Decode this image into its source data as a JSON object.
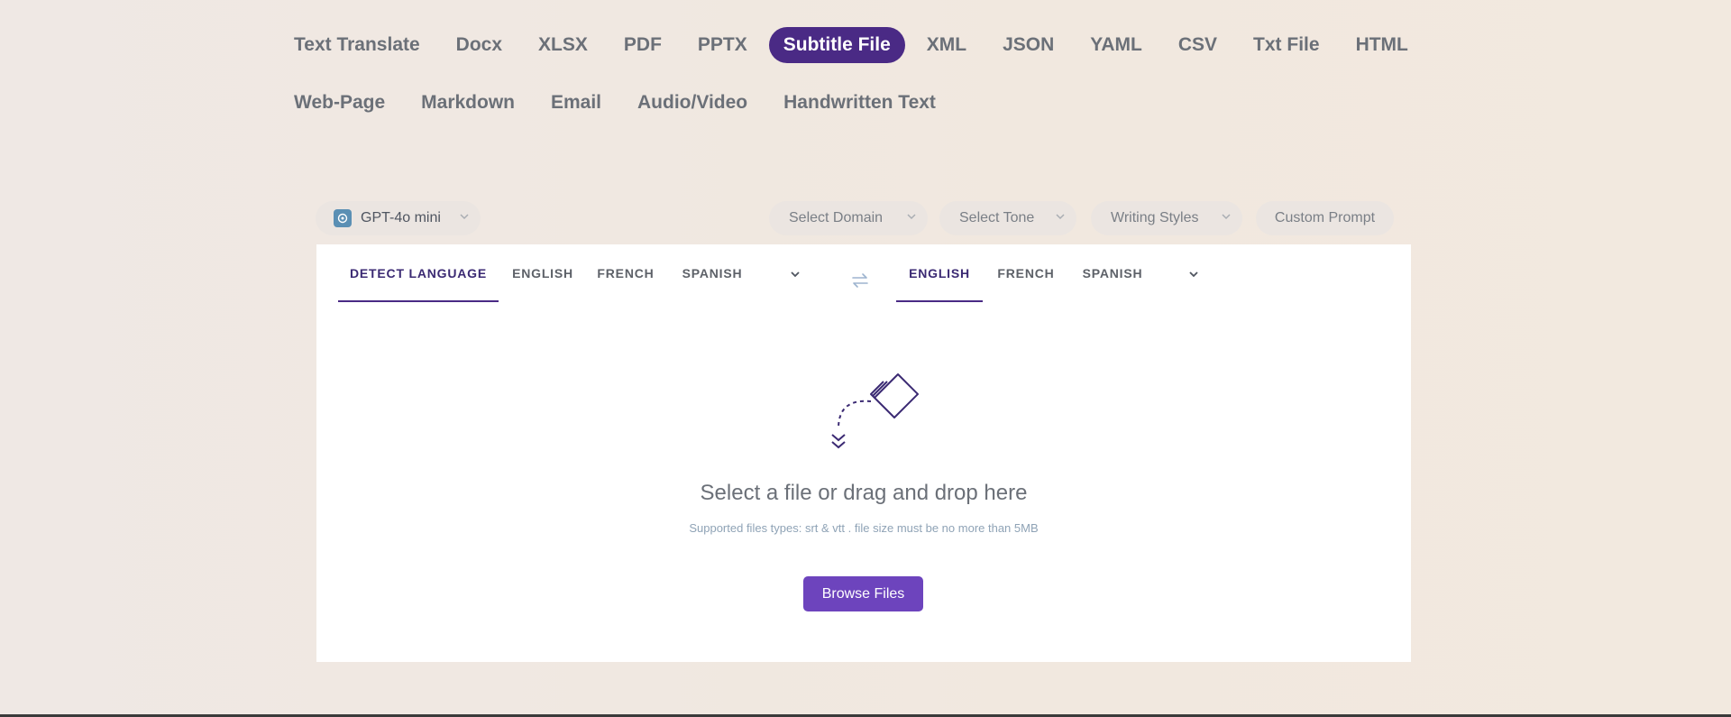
{
  "tabs_row1": [
    "Text Translate",
    "Docx",
    "XLSX",
    "PDF",
    "PPTX",
    "Subtitle File",
    "XML",
    "JSON",
    "YAML",
    "CSV",
    "Txt File",
    "HTML"
  ],
  "tabs_row2": [
    "Web-Page",
    "Markdown",
    "Email",
    "Audio/Video",
    "Handwritten Text"
  ],
  "active_tab": "Subtitle File",
  "toolbar": {
    "model": "GPT-4o mini",
    "domain": "Select Domain",
    "tone": "Select Tone",
    "styles": "Writing Styles",
    "prompt": "Custom Prompt"
  },
  "source_langs": [
    "DETECT LANGUAGE",
    "ENGLISH",
    "FRENCH",
    "SPANISH"
  ],
  "target_langs": [
    "ENGLISH",
    "FRENCH",
    "SPANISH"
  ],
  "upload": {
    "title": "Select a file or drag and drop here",
    "subtitle": "Supported files types: srt & vtt . file size must be no more than 5MB",
    "button": "Browse Files"
  },
  "colors": {
    "accent": "#4a2a85",
    "button": "#6d44bd"
  }
}
